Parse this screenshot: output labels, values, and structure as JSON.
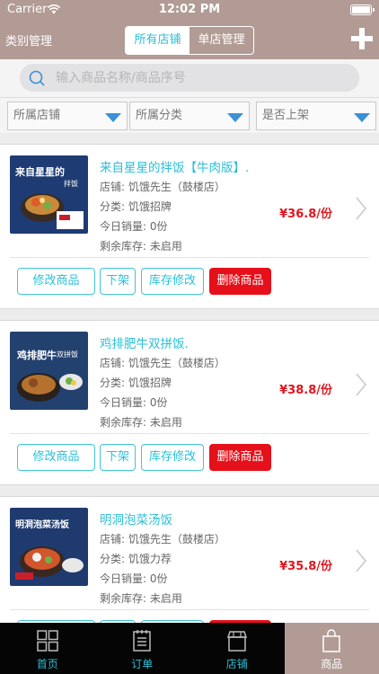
{
  "status_bar": {
    "carrier": "Carrier",
    "time": "12:02 PM"
  },
  "nav": {
    "left_label": "类别管理",
    "segments": [
      "所有店铺",
      "单店管理"
    ],
    "active_segment": 0,
    "add_icon": "plus-icon"
  },
  "search": {
    "placeholder": "输入商品名称/商品序号",
    "value": ""
  },
  "filters": [
    {
      "label": "所属店铺"
    },
    {
      "label": "所属分类"
    },
    {
      "label": "是否上架"
    }
  ],
  "products": [
    {
      "name": "来自星星的拌饭【牛肉版】.",
      "store": "店铺:  饥饿先生（鼓楼店）",
      "category": "分类:  饥饿招牌",
      "sales": "今日销量:  0份",
      "stock": "剩余库存:  未启用",
      "price": "¥36.8/份",
      "thumb_text": "来自星星的",
      "thumb_sub": "拌饭",
      "thumb_color": "#1e3b73"
    },
    {
      "name": "鸡排肥牛双拼饭.",
      "store": "店铺:  饥饿先生（鼓楼店）",
      "category": "分类:  饥饿招牌",
      "sales": "今日销量:  0份",
      "stock": "剩余库存:  未启用",
      "price": "¥38.8/份",
      "thumb_text": "鸡排肥牛",
      "thumb_sub": "双拼饭",
      "thumb_color": "#23416f"
    },
    {
      "name": "明洞泡菜汤饭",
      "store": "店铺:  饥饿先生（鼓楼店）",
      "category": "分类:  饥饿力荐",
      "sales": "今日销量:  0份",
      "stock": "剩余库存:  未启用",
      "price": "¥35.8/份",
      "thumb_text": "明洞泡菜汤饭",
      "thumb_sub": "",
      "thumb_color": "#1f3a6e"
    }
  ],
  "actions": {
    "edit": "修改商品",
    "off_shelf": "下架",
    "stock_edit": "库存修改",
    "delete": "删除商品"
  },
  "tabs": [
    {
      "label": "首页",
      "icon": "grid-icon"
    },
    {
      "label": "订单",
      "icon": "order-list-icon"
    },
    {
      "label": "店铺",
      "icon": "store-icon"
    },
    {
      "label": "商品",
      "icon": "shopping-bag-icon"
    }
  ],
  "active_tab": 3,
  "colors": {
    "nav": "#b29b95",
    "accent": "#2bbfd6",
    "price": "#e0141e",
    "delete": "#e6101a"
  }
}
